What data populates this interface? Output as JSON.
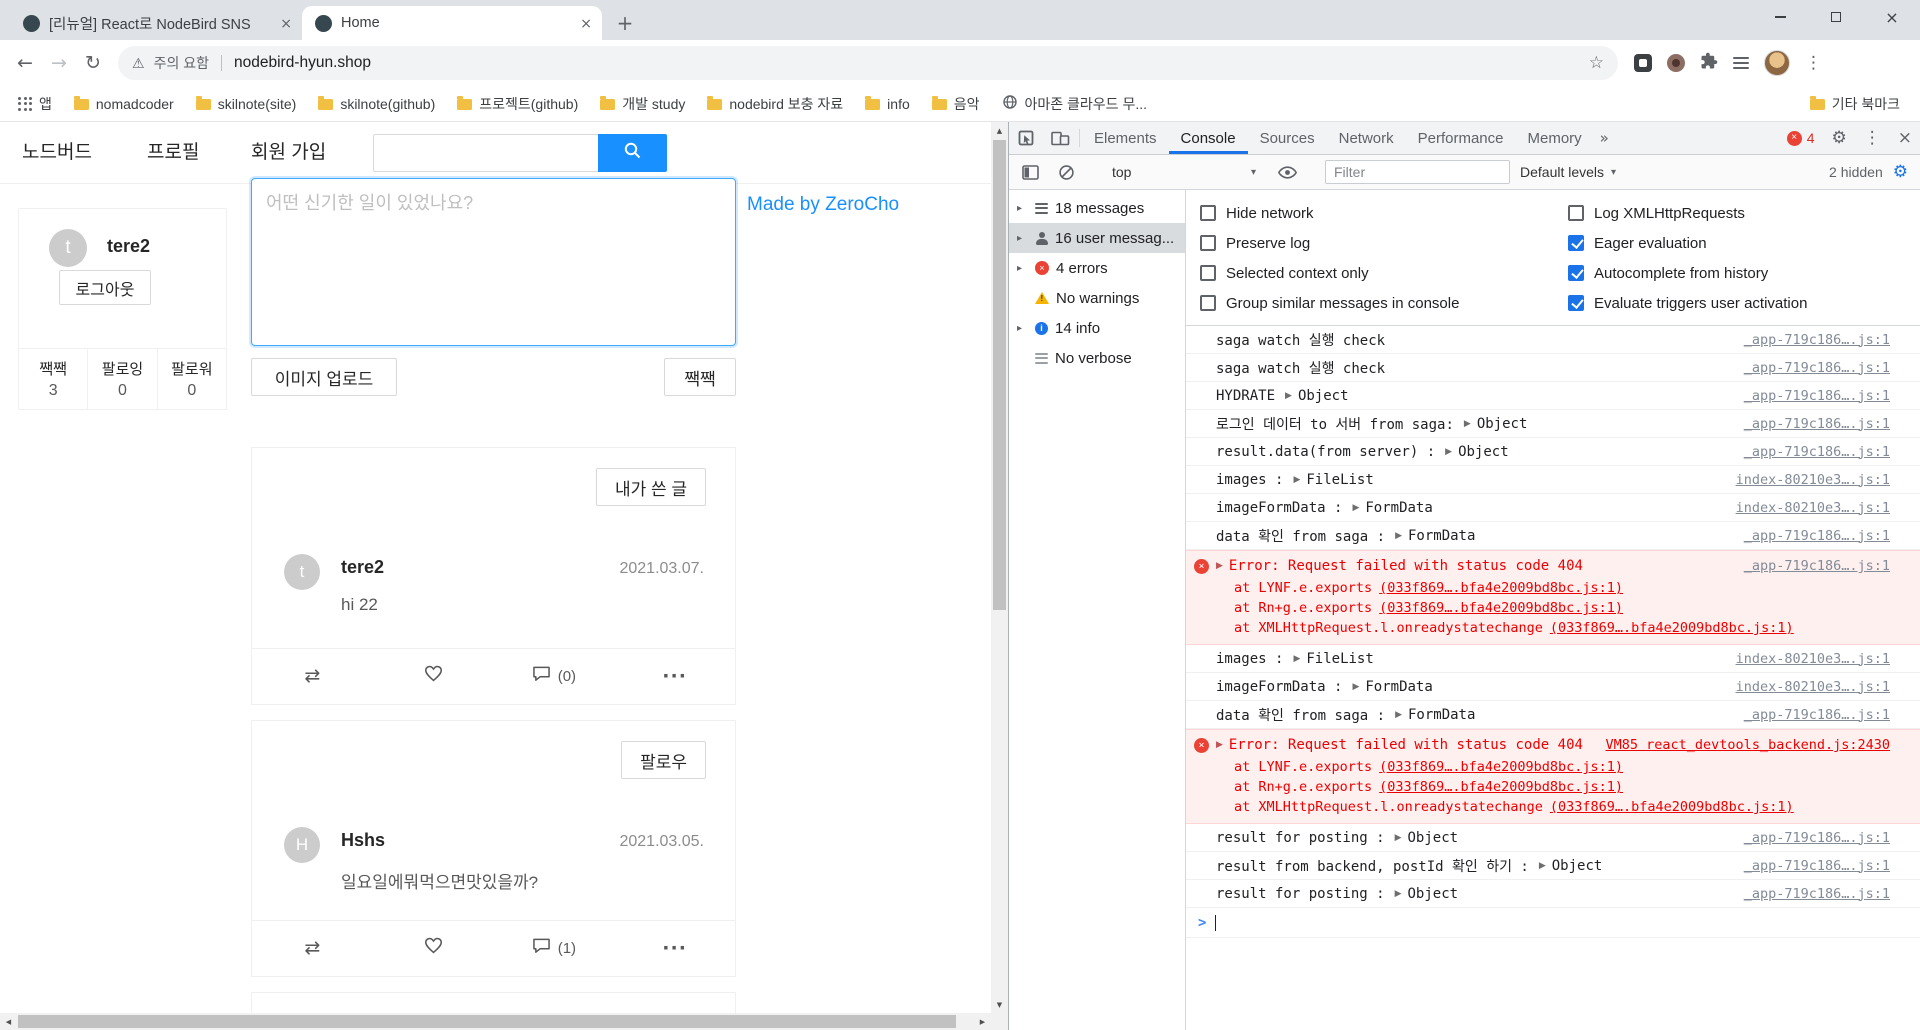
{
  "browser": {
    "tabs": [
      {
        "title": "[리뉴얼] React로 NodeBird SNS"
      },
      {
        "title": "Home"
      }
    ],
    "address": {
      "security": "주의 요함",
      "url": "nodebird-hyun.shop"
    },
    "bookmarks": {
      "items": [
        "앱",
        "nomadcoder",
        "skilnote(site)",
        "skilnote(github)",
        "프로젝트(github)",
        "개발 study",
        "nodebird 보충 자료",
        "info",
        "음악",
        "아마존 클라우드 무..."
      ],
      "other_label": "기타 북마크"
    }
  },
  "app": {
    "nav": {
      "brand": "노드버드",
      "profile": "프로필",
      "signup": "회원 가입"
    },
    "made_by": "Made by ZeroCho",
    "profile_card": {
      "avatar_initial": "t",
      "username": "tere2",
      "logout_label": "로그아웃",
      "stats": [
        {
          "label": "짹짹",
          "value": "3"
        },
        {
          "label": "팔로잉",
          "value": "0"
        },
        {
          "label": "팔로워",
          "value": "0"
        }
      ]
    },
    "composer": {
      "placeholder": "어떤 신기한 일이 있었나요?",
      "upload_label": "이미지 업로드",
      "tweet_label": "짹짹"
    },
    "posts": [
      {
        "header_button": "내가 쓴 글",
        "avatar_initial": "t",
        "author": "tere2",
        "date": "2021.03.07.",
        "content": "hi 22",
        "comment_count": "(0)"
      },
      {
        "header_button": "팔로우",
        "avatar_initial": "H",
        "author": "Hshs",
        "date": "2021.03.05.",
        "content": "일요일에뭐먹으면맛있을까?",
        "comment_count": "(1)"
      }
    ]
  },
  "devtools": {
    "tabs": [
      "Elements",
      "Console",
      "Sources",
      "Network",
      "Performance",
      "Memory"
    ],
    "active_tab": "Console",
    "error_badge": "4",
    "toolbar": {
      "context": "top",
      "filter_placeholder": "Filter",
      "levels": "Default levels",
      "hidden_count": "2 hidden"
    },
    "sidebar": [
      "18 messages",
      "16 user messag...",
      "4 errors",
      "No warnings",
      "14 info",
      "No verbose"
    ],
    "settings": {
      "column1": [
        "Hide network",
        "Preserve log",
        "Selected context only",
        "Group similar messages in console"
      ],
      "column1_checked": [
        false,
        false,
        false,
        false
      ],
      "column2": [
        "Log XMLHttpRequests",
        "Eager evaluation",
        "Autocomplete from history",
        "Evaluate triggers user activation"
      ],
      "column2_checked": [
        false,
        true,
        true,
        true
      ]
    },
    "messages": [
      {
        "text": "saga watch 실행 check",
        "link": "_app-719c186….js:1"
      },
      {
        "text": "saga watch 실행 check",
        "link": "_app-719c186….js:1"
      },
      {
        "text": "HYDRATE",
        "obj": "Object",
        "link": "_app-719c186….js:1"
      },
      {
        "text": "로그인 데이터 to 서버 from saga:",
        "obj": "Object",
        "link": "_app-719c186….js:1"
      },
      {
        "text": "result.data(from server) :",
        "obj": "Object",
        "link": "_app-719c186….js:1"
      },
      {
        "text": "images :",
        "obj": "FileList",
        "link": "index-80210e3….js:1"
      },
      {
        "text": "imageFormData :",
        "obj": "FormData",
        "link": "index-80210e3….js:1"
      },
      {
        "text": "data 확인 from saga :",
        "obj": "FormData",
        "link": "_app-719c186….js:1"
      },
      {
        "text": "Error: Request failed with status code 404",
        "link": "_app-719c186….js:1",
        "stack": [
          {
            "fn": "at LYNF.e.exports",
            "src": "(033f869….bfa4e2009bd8bc.js:1)"
          },
          {
            "fn": "at Rn+g.e.exports",
            "src": "(033f869….bfa4e2009bd8bc.js:1)"
          },
          {
            "fn": "at XMLHttpRequest.l.onreadystatechange",
            "src": "(033f869….bfa4e2009bd8bc.js:1)"
          }
        ]
      },
      {
        "text": "images :",
        "obj": "FileList",
        "link": "index-80210e3….js:1"
      },
      {
        "text": "imageFormData :",
        "obj": "FormData",
        "link": "index-80210e3….js:1"
      },
      {
        "text": "data 확인 from saga :",
        "obj": "FormData",
        "link": "_app-719c186….js:1"
      },
      {
        "text": "Error: Request failed with status code 404",
        "link": "VM85 react_devtools_backend.js:2430",
        "stack": [
          {
            "fn": "at LYNF.e.exports",
            "src": "(033f869….bfa4e2009bd8bc.js:1)"
          },
          {
            "fn": "at Rn+g.e.exports",
            "src": "(033f869….bfa4e2009bd8bc.js:1)"
          },
          {
            "fn": "at XMLHttpRequest.l.onreadystatechange",
            "src": "(033f869….bfa4e2009bd8bc.js:1)"
          }
        ]
      },
      {
        "text": "result for posting :",
        "obj": "Object",
        "link": "_app-719c186….js:1"
      },
      {
        "text": "result from backend, postId 확인 하기 :",
        "obj": "Object",
        "link": "_app-719c186….js:1"
      },
      {
        "text": "result for posting :",
        "obj": "Object",
        "link": "_app-719c186….js:1"
      }
    ],
    "prompt": ">"
  },
  "icons": {
    "back-icon": "←",
    "forward-icon": "→",
    "reload-icon": "↻",
    "star-icon": "☆",
    "warning-icon": "⚠",
    "kebab-menu-icon": "⋮",
    "new-tab-icon": "+",
    "close-icon": "×",
    "gear-icon": "⚙",
    "caret-down-icon": "▾",
    "disclosure-icon": "▸",
    "expand-icon": "▶",
    "more-tabs-icon": "»",
    "retweet-icon": "⇄",
    "heart-icon": "css-shape",
    "comment-icon": "css-shape",
    "ellipsis-icon": "···",
    "search-icon": "css-shape",
    "folder-icon": "css-shape",
    "apps-grid-icon": "css-shape",
    "globe-icon": "css-shape",
    "error-icon": "css-shape",
    "info-icon": "css-shape",
    "person-icon": "css-shape",
    "prompt-icon": ">"
  }
}
